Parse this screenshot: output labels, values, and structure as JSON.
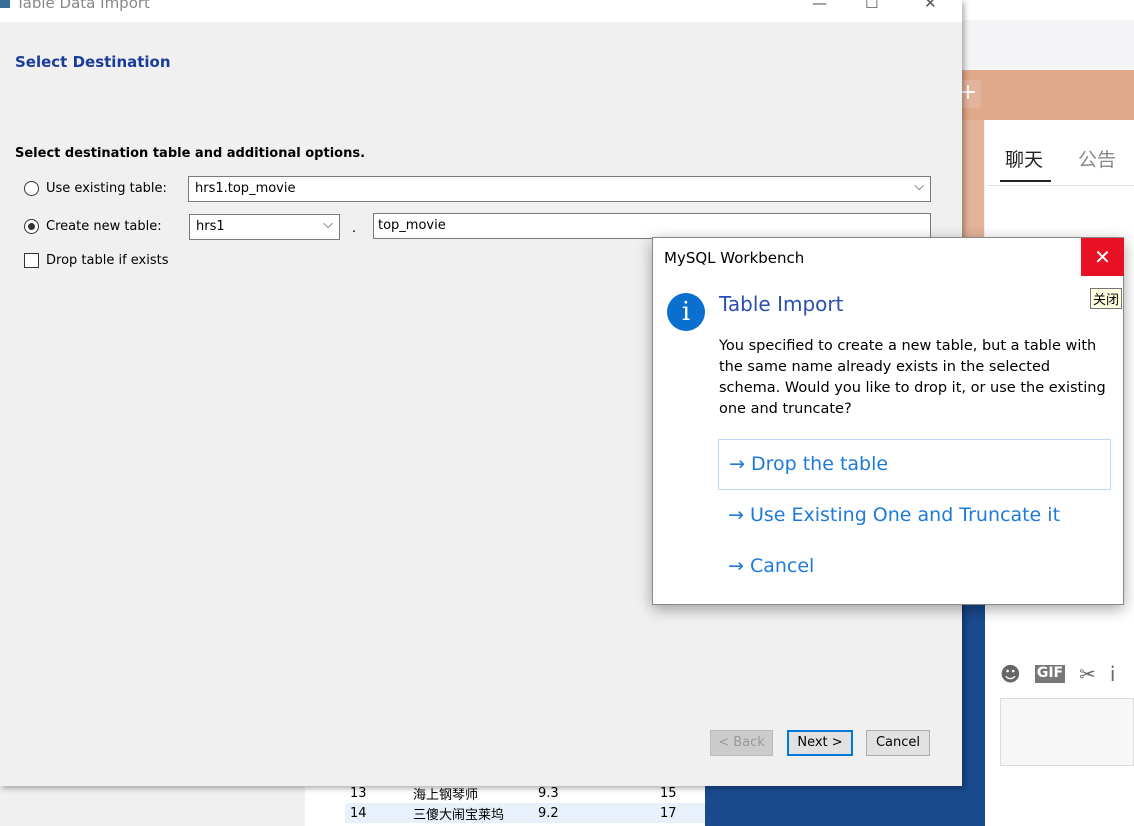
{
  "window": {
    "title": "Table Data Import",
    "minimize": "—",
    "maximize": "☐",
    "close": "✕"
  },
  "page": {
    "heading": "Select Destination",
    "subheading": "Select destination table and additional options."
  },
  "options": {
    "use_existing": {
      "label": "Use existing table:",
      "value": "hrs1.top_movie",
      "selected": false
    },
    "create_new": {
      "label": "Create new table:",
      "schema": "hrs1",
      "dot": ".",
      "table": "top_movie",
      "selected": true
    },
    "drop_if_exists": {
      "label": "Drop table if exists",
      "checked": false
    }
  },
  "buttons": {
    "back": "< Back",
    "next": "Next >",
    "cancel": "Cancel"
  },
  "dialog": {
    "title": "MySQL Workbench",
    "heading": "Table Import",
    "message": "You specified to create a new table, but a table with the same name already exists in the selected schema. Would you like to drop it, or use the existing one and truncate?",
    "options": [
      "Drop the table",
      "Use Existing One and Truncate it",
      "Cancel"
    ],
    "arrow": "→",
    "close_tooltip": "关闭",
    "icon": "info-icon",
    "accent": "#1e7ad9"
  },
  "background": {
    "chat_tabs": [
      "聊天",
      "公告"
    ],
    "chat_tools": [
      "☻",
      "GIF",
      "✂",
      "i"
    ],
    "table_rows": [
      {
        "id": "13",
        "title": "海上钢琴师",
        "score": "9.3",
        "extra": "15"
      },
      {
        "id": "14",
        "title": "三傻大闹宝莱坞",
        "score": "9.2",
        "extra": "17"
      }
    ]
  }
}
